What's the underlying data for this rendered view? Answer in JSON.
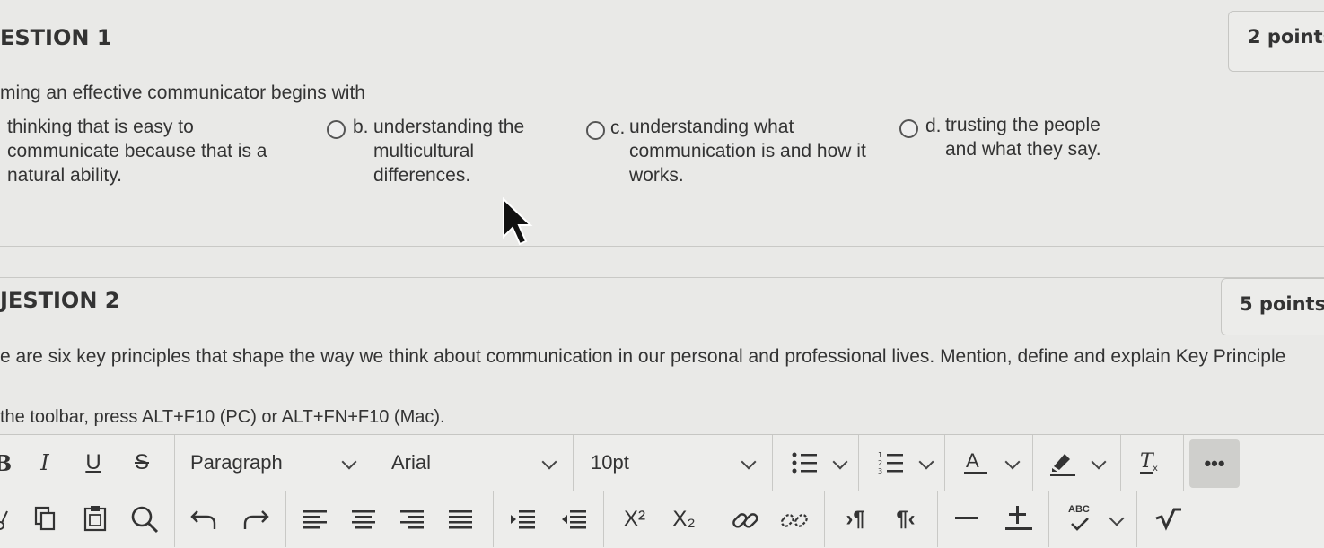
{
  "question1": {
    "title": "ESTION 1",
    "points": "2 points",
    "stem": "ming an effective communicator begins with",
    "options": [
      {
        "letter": "",
        "text": "thinking that is easy to\ncommunicate because that is a\nnatural ability."
      },
      {
        "letter": "b.",
        "text": "understanding the\nmulticultural\ndifferences."
      },
      {
        "letter": "c.",
        "text": "understanding what\ncommunication is and how it\nworks."
      },
      {
        "letter": "d.",
        "text": "trusting the people\nand what they say."
      }
    ]
  },
  "question2": {
    "title": "JESTION 2",
    "points": "5 points",
    "stem": "e are six key principles that shape the way we think about communication in our personal and professional lives. Mention, define and explain Key Principle",
    "toolbar_hint": "the toolbar, press ALT+F10 (PC) or ALT+FN+F10 (Mac)."
  },
  "toolbar": {
    "row1": {
      "bold": "B",
      "italic": "I",
      "underline": "U",
      "strike": "S",
      "paragraph_select": "Paragraph",
      "font_select": "Arial",
      "size_select": "10pt",
      "more": "•••"
    },
    "row2": {
      "superscript": "X²",
      "subscript": "X₂",
      "ltr": "›¶",
      "rtl": "¶‹",
      "spellcheck": "ABC"
    }
  }
}
